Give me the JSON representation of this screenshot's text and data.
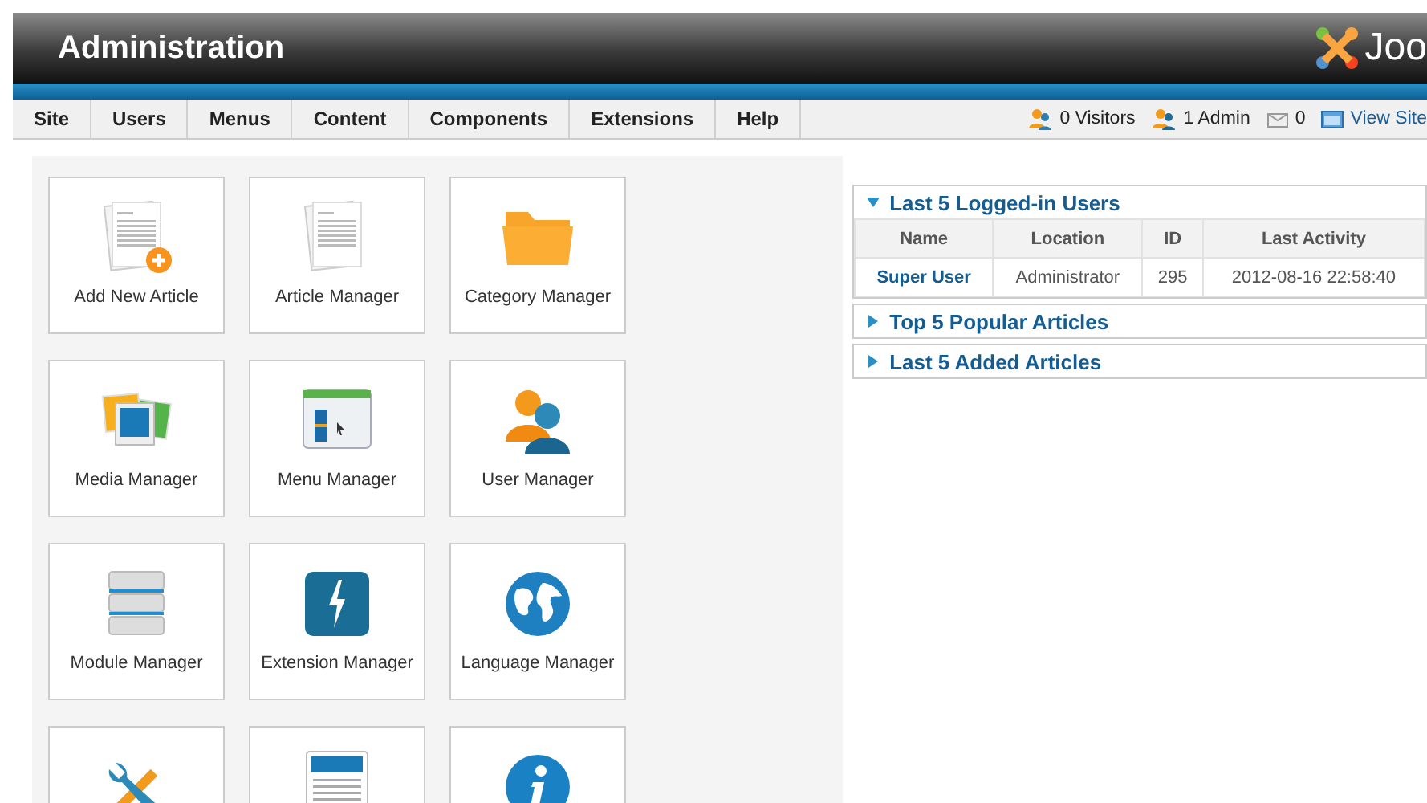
{
  "header": {
    "title": "Administration",
    "logo_text": "Joo"
  },
  "menu": [
    {
      "label": "Site"
    },
    {
      "label": "Users"
    },
    {
      "label": "Menus"
    },
    {
      "label": "Content"
    },
    {
      "label": "Components"
    },
    {
      "label": "Extensions"
    },
    {
      "label": "Help"
    }
  ],
  "status": [
    {
      "kind": "visitors",
      "text": "0 Visitors"
    },
    {
      "kind": "admins",
      "text": "1 Admin"
    },
    {
      "kind": "messages",
      "text": "0"
    },
    {
      "kind": "site",
      "text": "View Site"
    }
  ],
  "quickicons": [
    {
      "kind": "add-article",
      "label": "Add New Article"
    },
    {
      "kind": "article",
      "label": "Article Manager"
    },
    {
      "kind": "folder",
      "label": "Category Manager"
    },
    {
      "kind": "media",
      "label": "Media Manager"
    },
    {
      "kind": "menu",
      "label": "Menu Manager"
    },
    {
      "kind": "users",
      "label": "User Manager"
    },
    {
      "kind": "modules",
      "label": "Module Manager"
    },
    {
      "kind": "extension",
      "label": "Extension Manager"
    },
    {
      "kind": "globe",
      "label": "Language Manager"
    },
    {
      "kind": "tools"
    },
    {
      "kind": "template"
    },
    {
      "kind": "info"
    }
  ],
  "panels": [
    {
      "title": "Last 5 Logged-in Users",
      "expanded": true,
      "table": {
        "columns": [
          "Name",
          "Location",
          "ID",
          "Last Activity"
        ],
        "rows": [
          [
            "Super User",
            "Administrator",
            "295",
            "2012-08-16 22:58:40"
          ]
        ]
      }
    },
    {
      "title": "Top 5 Popular Articles",
      "expanded": false
    },
    {
      "title": "Last 5 Added Articles",
      "expanded": false
    }
  ]
}
